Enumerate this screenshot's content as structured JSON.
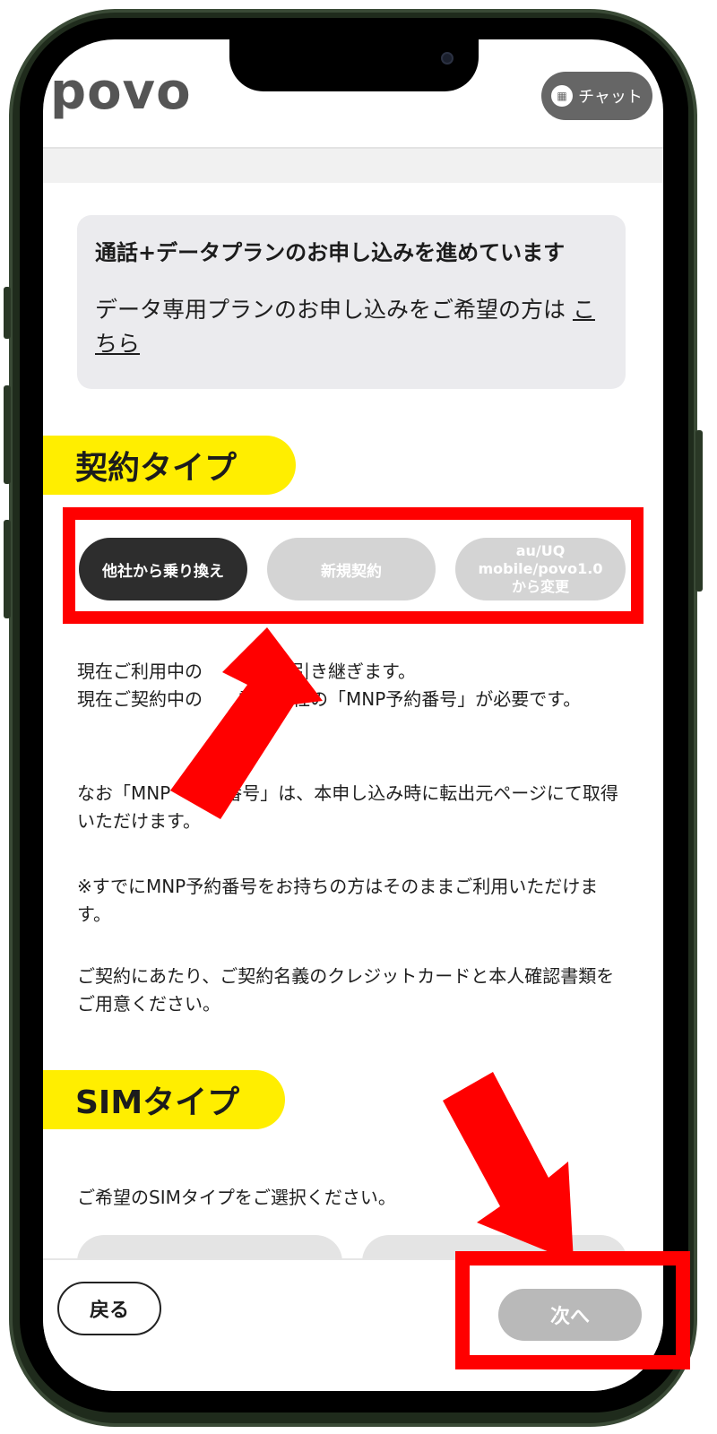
{
  "header": {
    "logo_text": "povo",
    "chat_label": "チャット",
    "chat_icon": "chat-icon"
  },
  "notice": {
    "title": "通話+データプランのお申し込みを進めています",
    "text": "データ専用プランのお申し込みをご希望の方は ",
    "link": "こちら"
  },
  "contract": {
    "label": "契約タイプ",
    "options": [
      {
        "label": "他社から乗り換え",
        "selected": true
      },
      {
        "label": "新規契約",
        "selected": false
      },
      {
        "label": "au/UQ mobile/povo1.0から変更",
        "selected": false
      }
    ],
    "paragraphs": [
      "現在ご利用中の　　　号を引き継ぎます。\n現在ご契約中の　　電話会社の「MNP予約番号」が必要です。",
      "なお「MNP　　約番号」は、本申し込み時に転出元ページにて取得いただけます。",
      "※すでにMNP予約番号をお持ちの方はそのままご利用いただけます。",
      "ご契約にあたり、ご契約名義のクレジットカードと本人確認書類をご用意ください。"
    ]
  },
  "sim": {
    "label": "SIMタイプ",
    "description": "ご希望のSIMタイプをご選択ください。"
  },
  "footer": {
    "back_label": "戻る",
    "next_label": "次へ"
  },
  "colors": {
    "accent_yellow": "#ffee00",
    "highlight_red": "#ff0000",
    "selected_dark": "#2d2d2d",
    "disabled_gray": "#d4d4d4"
  }
}
